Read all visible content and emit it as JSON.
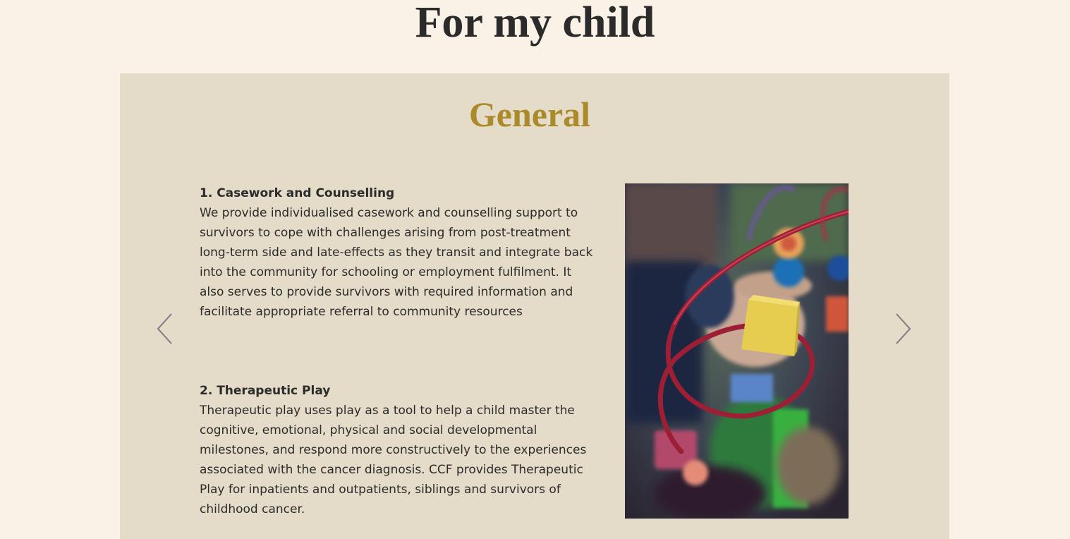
{
  "page": {
    "title": "For my child"
  },
  "section": {
    "title": "General"
  },
  "carousel": {
    "prev_icon": "chevron-left-icon",
    "next_icon": "chevron-right-icon"
  },
  "items": [
    {
      "heading": "1. Casework and Counselling",
      "body": "We provide individualised casework and counselling support to survivors to cope with challenges arising from post-treatment long-term side and late-effects as they transit and integrate back into the community for schooling or employment fulfilment. It also serves to provide survivors with required information and facilitate appropriate referral to community resources"
    },
    {
      "heading": "2. Therapeutic Play",
      "body": "Therapeutic play uses play as a tool to help a child master the cognitive, emotional, physical and social developmental milestones, and respond more constructively to the experiences associated with the cancer diagnosis. CCF provides Therapeutic Play for inpatients and outpatients, siblings and survivors of childhood cancer."
    }
  ],
  "colors": {
    "page_background": "#faf2e7",
    "panel_background": "#e4dcc8",
    "section_title": "#ab8a2c",
    "text": "#2b2b2b",
    "arrow": "#7f7b86"
  }
}
